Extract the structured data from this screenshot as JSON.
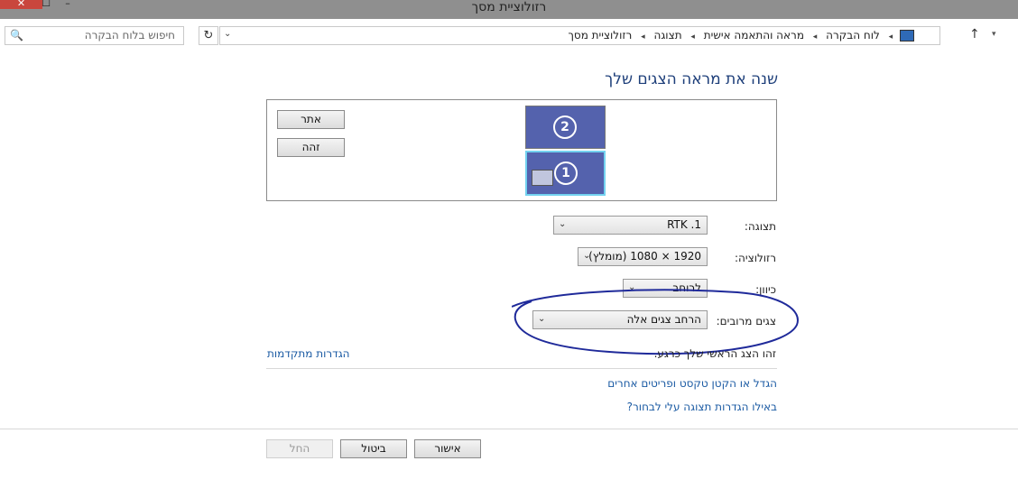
{
  "window": {
    "title": "רזולוציית מסך",
    "close_glyph": "✕",
    "max_glyph": "☐",
    "min_glyph": "–"
  },
  "address": {
    "search_placeholder": "חיפוש בלוח הבקרה",
    "search_icon": "🔍",
    "refresh_glyph": "↻",
    "dropdown_glyph": "⌄",
    "breadcrumbs": [
      "לוח הבקרה",
      "מראה והתאמה אישית",
      "תצוגה",
      "רזולוציית מסך"
    ],
    "sep_glyph": "◂",
    "up_glyph": "↑",
    "history_glyph": "▾"
  },
  "main": {
    "title": "שנה את מראה הצגים שלך",
    "detect_label": "אתר",
    "identify_label": "זהה",
    "monitor1_num": "1",
    "monitor2_num": "2",
    "display_label": "תצוגה:",
    "display_value": "RTK .1",
    "resolution_label": "רזולוציה:",
    "resolution_value": "1920 × 1080 (מומלץ)",
    "orientation_label": "כיוון:",
    "orientation_value": "לרוחב",
    "multiple_label": "צגים מרובים:",
    "multiple_value": "הרחב צגים אלה",
    "primary_note": "זהו הצג הראשי שלך כרגע.",
    "advanced_link": "הגדרות מתקדמות",
    "text_size_link": "הגדל או הקטן טקסט ופריטים אחרים",
    "which_settings_link": "באילו הגדרות תצוגה עלי לבחור?",
    "arrow_glyph": "⌄"
  },
  "footer": {
    "ok_label": "אישור",
    "cancel_label": "ביטול",
    "apply_label": "החל"
  },
  "colors": {
    "link": "#1a5aa3",
    "title": "#1e3f7a",
    "monitor": "#5462ad",
    "annotation": "#1f2a9a"
  }
}
